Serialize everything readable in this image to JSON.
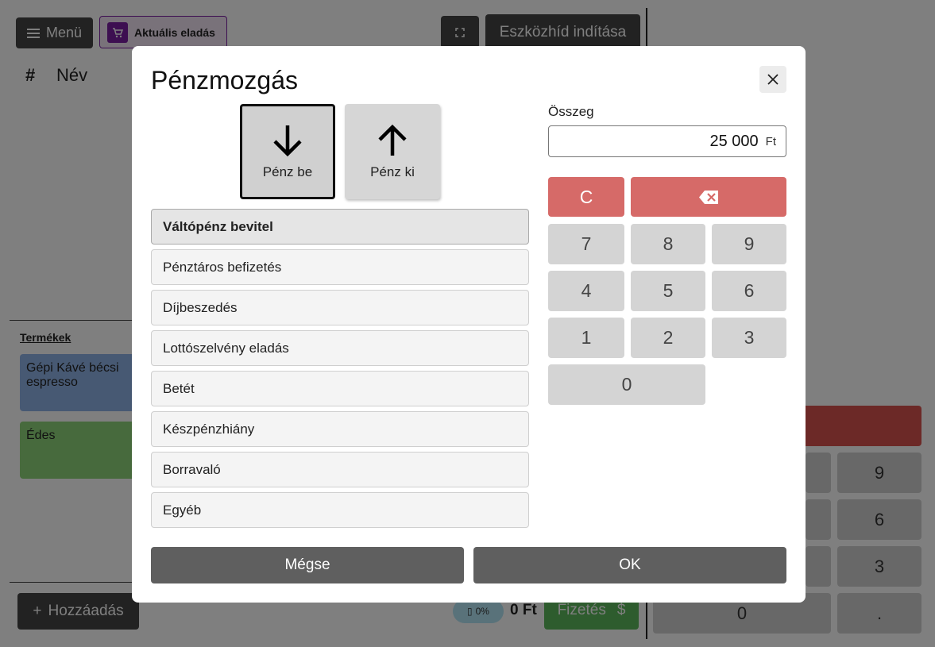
{
  "background": {
    "menu_label": "Menü",
    "current_sale_label": "Aktuális eladás",
    "device_bridge_label": "Eszközhíd indítása",
    "columns": {
      "hash": "#",
      "name": "Név"
    },
    "products_title": "Termékek",
    "products": [
      {
        "name": "Gépi Kávé bécsi espresso",
        "color": "#8fb2e6"
      },
      {
        "name": "Édes",
        "color": "#8ed47a"
      }
    ],
    "add_label": "Hozzáadás",
    "tax_badge": "0%",
    "total": "0 Ft",
    "pay_label": "Fizetés",
    "pay_symbol": "$",
    "keypad": {
      "k9": "9",
      "k6": "6",
      "k3": "3",
      "k0": "0",
      "dot": "."
    }
  },
  "modal": {
    "title": "Pénzmozgás",
    "direction_in": "Pénz be",
    "direction_out": "Pénz ki",
    "selected_direction": "Pénz be",
    "types": [
      "Váltópénz bevitel",
      "Pénztáros befizetés",
      "Díjbeszedés",
      "Lottószelvény eladás",
      "Betét",
      "Készpénzhiány",
      "Borravaló",
      "Egyéb"
    ],
    "selected_type": "Váltópénz bevitel",
    "amount_label": "Összeg",
    "amount_value": "25 000",
    "amount_unit": "Ft",
    "keypad": {
      "clear": "C",
      "k7": "7",
      "k8": "8",
      "k9": "9",
      "k4": "4",
      "k5": "5",
      "k6": "6",
      "k1": "1",
      "k2": "2",
      "k3": "3",
      "k0": "0"
    },
    "cancel_label": "Mégse",
    "ok_label": "OK"
  },
  "colors": {
    "accent_purple": "#7b1fa2",
    "danger": "#d66a68",
    "dark_button": "#5f5f5f"
  }
}
